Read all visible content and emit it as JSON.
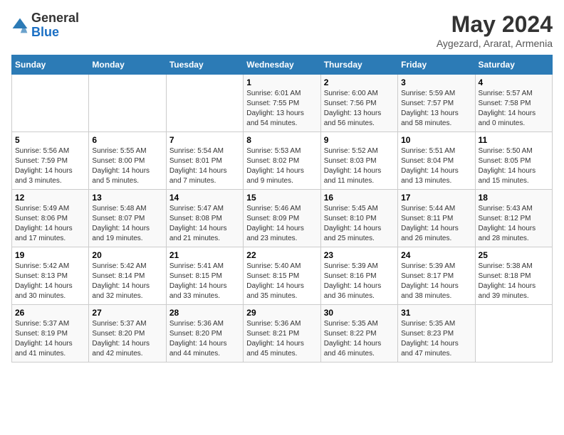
{
  "logo": {
    "line1": "General",
    "line2": "Blue"
  },
  "title": "May 2024",
  "subtitle": "Aygezard, Ararat, Armenia",
  "weekdays": [
    "Sunday",
    "Monday",
    "Tuesday",
    "Wednesday",
    "Thursday",
    "Friday",
    "Saturday"
  ],
  "weeks": [
    [
      {
        "day": "",
        "sunrise": "",
        "sunset": "",
        "daylight": ""
      },
      {
        "day": "",
        "sunrise": "",
        "sunset": "",
        "daylight": ""
      },
      {
        "day": "",
        "sunrise": "",
        "sunset": "",
        "daylight": ""
      },
      {
        "day": "1",
        "sunrise": "Sunrise: 6:01 AM",
        "sunset": "Sunset: 7:55 PM",
        "daylight": "Daylight: 13 hours and 54 minutes."
      },
      {
        "day": "2",
        "sunrise": "Sunrise: 6:00 AM",
        "sunset": "Sunset: 7:56 PM",
        "daylight": "Daylight: 13 hours and 56 minutes."
      },
      {
        "day": "3",
        "sunrise": "Sunrise: 5:59 AM",
        "sunset": "Sunset: 7:57 PM",
        "daylight": "Daylight: 13 hours and 58 minutes."
      },
      {
        "day": "4",
        "sunrise": "Sunrise: 5:57 AM",
        "sunset": "Sunset: 7:58 PM",
        "daylight": "Daylight: 14 hours and 0 minutes."
      }
    ],
    [
      {
        "day": "5",
        "sunrise": "Sunrise: 5:56 AM",
        "sunset": "Sunset: 7:59 PM",
        "daylight": "Daylight: 14 hours and 3 minutes."
      },
      {
        "day": "6",
        "sunrise": "Sunrise: 5:55 AM",
        "sunset": "Sunset: 8:00 PM",
        "daylight": "Daylight: 14 hours and 5 minutes."
      },
      {
        "day": "7",
        "sunrise": "Sunrise: 5:54 AM",
        "sunset": "Sunset: 8:01 PM",
        "daylight": "Daylight: 14 hours and 7 minutes."
      },
      {
        "day": "8",
        "sunrise": "Sunrise: 5:53 AM",
        "sunset": "Sunset: 8:02 PM",
        "daylight": "Daylight: 14 hours and 9 minutes."
      },
      {
        "day": "9",
        "sunrise": "Sunrise: 5:52 AM",
        "sunset": "Sunset: 8:03 PM",
        "daylight": "Daylight: 14 hours and 11 minutes."
      },
      {
        "day": "10",
        "sunrise": "Sunrise: 5:51 AM",
        "sunset": "Sunset: 8:04 PM",
        "daylight": "Daylight: 14 hours and 13 minutes."
      },
      {
        "day": "11",
        "sunrise": "Sunrise: 5:50 AM",
        "sunset": "Sunset: 8:05 PM",
        "daylight": "Daylight: 14 hours and 15 minutes."
      }
    ],
    [
      {
        "day": "12",
        "sunrise": "Sunrise: 5:49 AM",
        "sunset": "Sunset: 8:06 PM",
        "daylight": "Daylight: 14 hours and 17 minutes."
      },
      {
        "day": "13",
        "sunrise": "Sunrise: 5:48 AM",
        "sunset": "Sunset: 8:07 PM",
        "daylight": "Daylight: 14 hours and 19 minutes."
      },
      {
        "day": "14",
        "sunrise": "Sunrise: 5:47 AM",
        "sunset": "Sunset: 8:08 PM",
        "daylight": "Daylight: 14 hours and 21 minutes."
      },
      {
        "day": "15",
        "sunrise": "Sunrise: 5:46 AM",
        "sunset": "Sunset: 8:09 PM",
        "daylight": "Daylight: 14 hours and 23 minutes."
      },
      {
        "day": "16",
        "sunrise": "Sunrise: 5:45 AM",
        "sunset": "Sunset: 8:10 PM",
        "daylight": "Daylight: 14 hours and 25 minutes."
      },
      {
        "day": "17",
        "sunrise": "Sunrise: 5:44 AM",
        "sunset": "Sunset: 8:11 PM",
        "daylight": "Daylight: 14 hours and 26 minutes."
      },
      {
        "day": "18",
        "sunrise": "Sunrise: 5:43 AM",
        "sunset": "Sunset: 8:12 PM",
        "daylight": "Daylight: 14 hours and 28 minutes."
      }
    ],
    [
      {
        "day": "19",
        "sunrise": "Sunrise: 5:42 AM",
        "sunset": "Sunset: 8:13 PM",
        "daylight": "Daylight: 14 hours and 30 minutes."
      },
      {
        "day": "20",
        "sunrise": "Sunrise: 5:42 AM",
        "sunset": "Sunset: 8:14 PM",
        "daylight": "Daylight: 14 hours and 32 minutes."
      },
      {
        "day": "21",
        "sunrise": "Sunrise: 5:41 AM",
        "sunset": "Sunset: 8:15 PM",
        "daylight": "Daylight: 14 hours and 33 minutes."
      },
      {
        "day": "22",
        "sunrise": "Sunrise: 5:40 AM",
        "sunset": "Sunset: 8:15 PM",
        "daylight": "Daylight: 14 hours and 35 minutes."
      },
      {
        "day": "23",
        "sunrise": "Sunrise: 5:39 AM",
        "sunset": "Sunset: 8:16 PM",
        "daylight": "Daylight: 14 hours and 36 minutes."
      },
      {
        "day": "24",
        "sunrise": "Sunrise: 5:39 AM",
        "sunset": "Sunset: 8:17 PM",
        "daylight": "Daylight: 14 hours and 38 minutes."
      },
      {
        "day": "25",
        "sunrise": "Sunrise: 5:38 AM",
        "sunset": "Sunset: 8:18 PM",
        "daylight": "Daylight: 14 hours and 39 minutes."
      }
    ],
    [
      {
        "day": "26",
        "sunrise": "Sunrise: 5:37 AM",
        "sunset": "Sunset: 8:19 PM",
        "daylight": "Daylight: 14 hours and 41 minutes."
      },
      {
        "day": "27",
        "sunrise": "Sunrise: 5:37 AM",
        "sunset": "Sunset: 8:20 PM",
        "daylight": "Daylight: 14 hours and 42 minutes."
      },
      {
        "day": "28",
        "sunrise": "Sunrise: 5:36 AM",
        "sunset": "Sunset: 8:20 PM",
        "daylight": "Daylight: 14 hours and 44 minutes."
      },
      {
        "day": "29",
        "sunrise": "Sunrise: 5:36 AM",
        "sunset": "Sunset: 8:21 PM",
        "daylight": "Daylight: 14 hours and 45 minutes."
      },
      {
        "day": "30",
        "sunrise": "Sunrise: 5:35 AM",
        "sunset": "Sunset: 8:22 PM",
        "daylight": "Daylight: 14 hours and 46 minutes."
      },
      {
        "day": "31",
        "sunrise": "Sunrise: 5:35 AM",
        "sunset": "Sunset: 8:23 PM",
        "daylight": "Daylight: 14 hours and 47 minutes."
      },
      {
        "day": "",
        "sunrise": "",
        "sunset": "",
        "daylight": ""
      }
    ]
  ]
}
